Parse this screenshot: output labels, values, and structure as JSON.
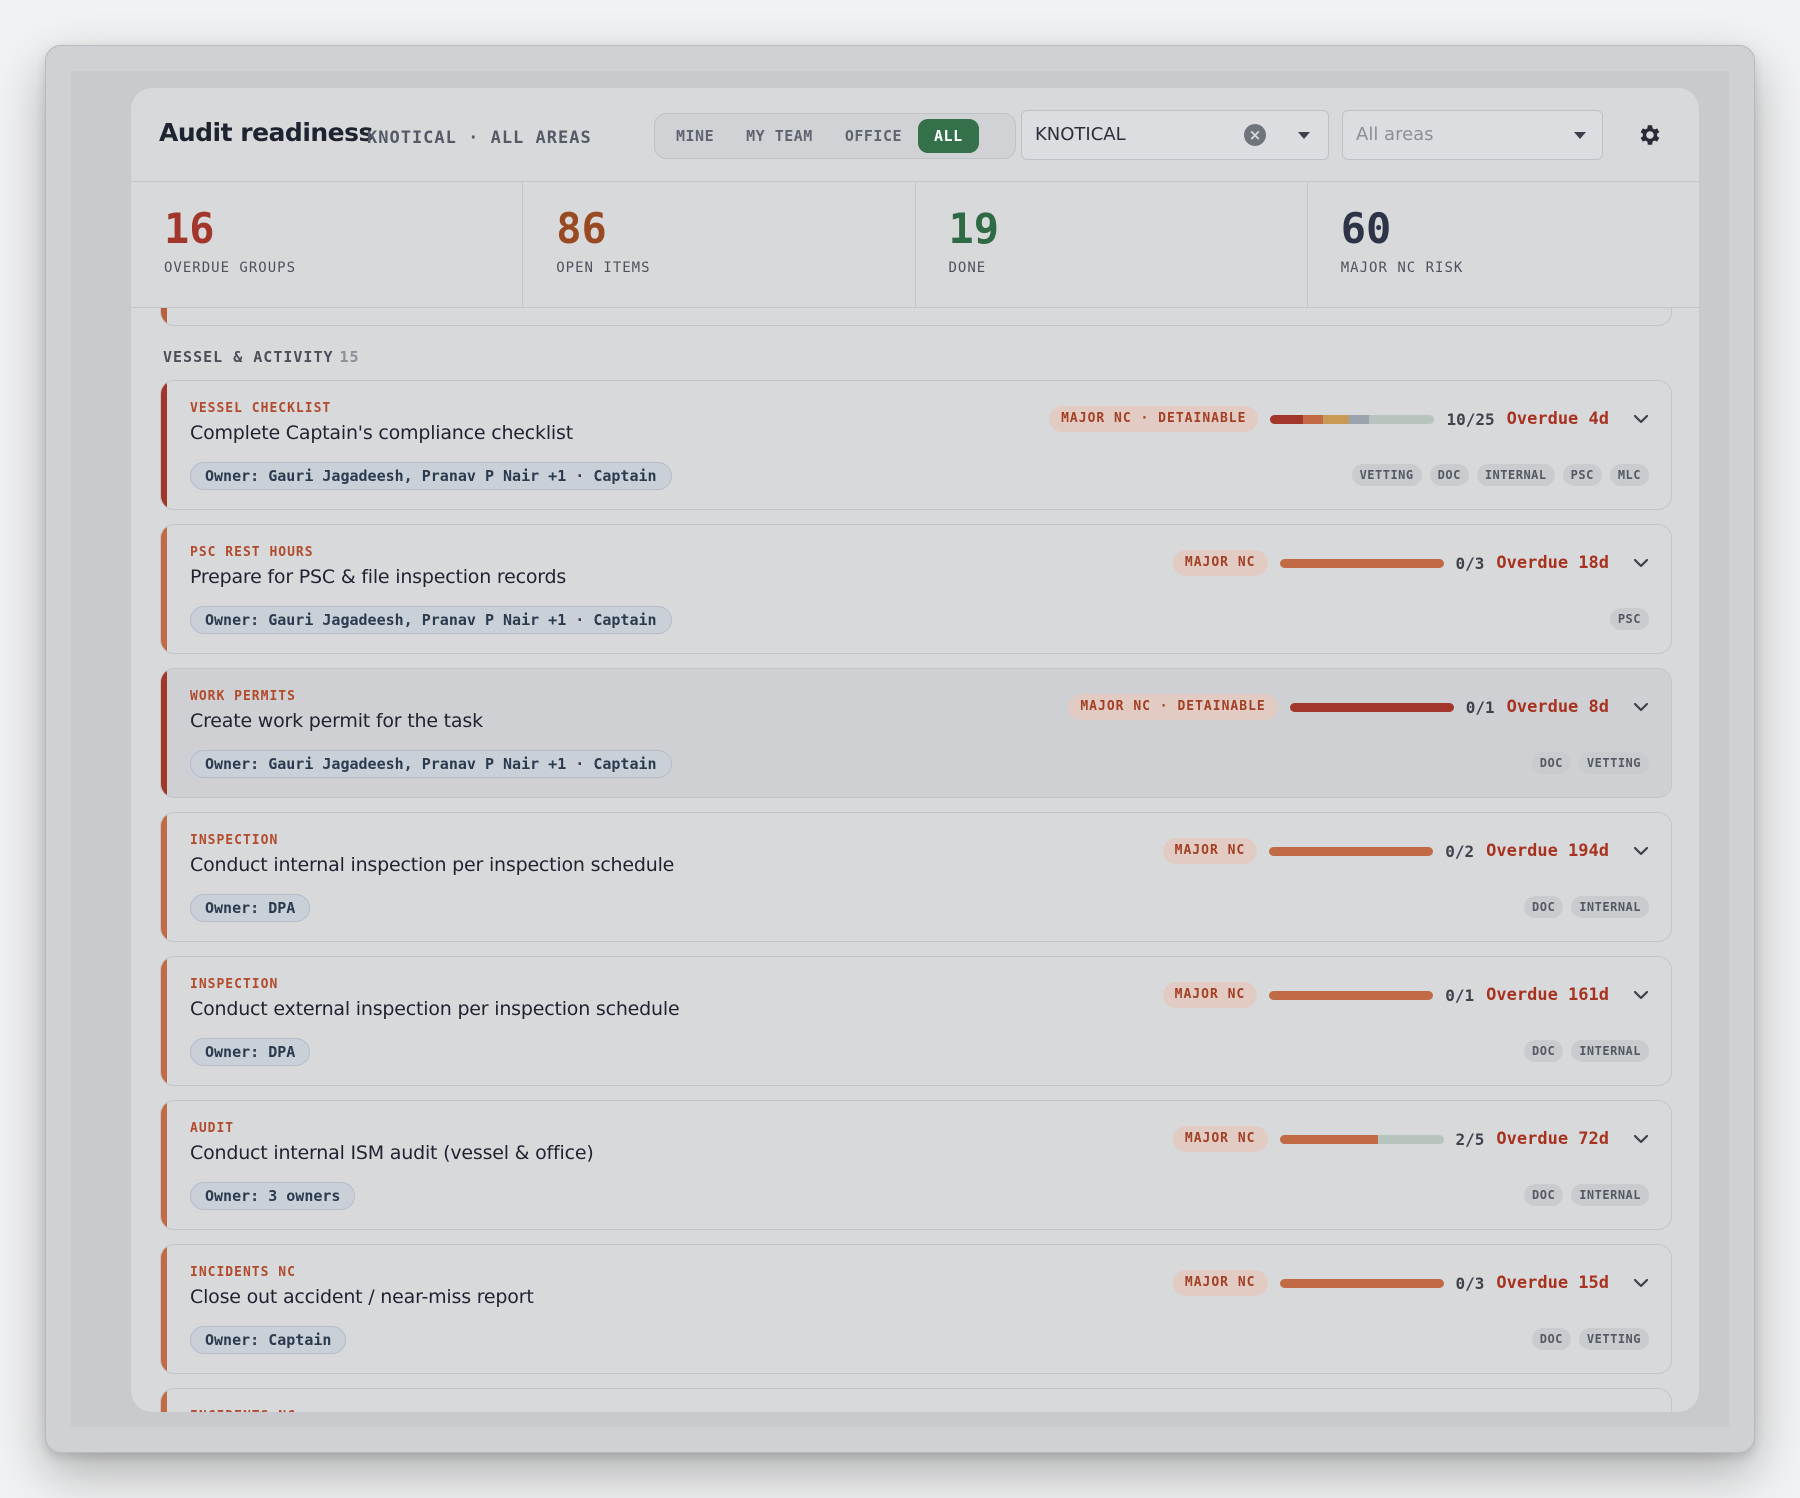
{
  "header": {
    "title": "Audit readiness",
    "subtitle": "KNOTICAL · ALL AREAS",
    "scope_tabs": [
      {
        "label": "MINE",
        "active": false
      },
      {
        "label": "MY TEAM",
        "active": false
      },
      {
        "label": "OFFICE",
        "active": false
      },
      {
        "label": "ALL",
        "active": true
      }
    ],
    "vessel_select": {
      "value": "KNOTICAL",
      "clear_icon": "close-circle-icon",
      "caret_icon": "caret-down-icon"
    },
    "area_select": {
      "placeholder": "All areas",
      "caret_icon": "caret-down-icon"
    },
    "settings_icon": "gear-icon"
  },
  "stats": [
    {
      "value": "16",
      "label": "OVERDUE GROUPS",
      "color": "#a3362a"
    },
    {
      "value": "86",
      "label": "OPEN ITEMS",
      "color": "#9a4a22"
    },
    {
      "value": "19",
      "label": "DONE",
      "color": "#2f6a45"
    },
    {
      "value": "60",
      "label": "MAJOR NC RISK",
      "color": "#2e3447"
    }
  ],
  "section": {
    "label": "VESSEL & ACTIVITY",
    "count": "15"
  },
  "colors": {
    "critical_accent": "#a3362a",
    "major_accent": "#c16a45",
    "active_tab": "#34704a",
    "overdue_text": "#a83220"
  },
  "cards": [
    {
      "category": "VESSEL CHECKLIST",
      "title": "Complete Captain's compliance checklist",
      "owner": "Owner: Gauri Jagadeesh, Pranav P Nair +1 · Captain",
      "badge": "MAJOR NC · DETAINABLE",
      "progress_text": "10/25",
      "progress": 0.4,
      "segments": [
        {
          "value": 0.2,
          "color": "#a3362a"
        },
        {
          "value": 0.12,
          "color": "#c16a45"
        },
        {
          "value": 0.16,
          "color": "#c99a55"
        },
        {
          "value": 0.12,
          "color": "#9aa3ae"
        }
      ],
      "status": "Overdue 4d",
      "tags": [
        "VETTING",
        "DOC",
        "INTERNAL",
        "PSC",
        "MLC"
      ],
      "accent": "#a3362a",
      "hover": false
    },
    {
      "category": "PSC REST HOURS",
      "title": "Prepare for PSC & file inspection records",
      "owner": "Owner: Gauri Jagadeesh, Pranav P Nair +1 · Captain",
      "badge": "MAJOR NC",
      "progress_text": "0/3",
      "progress": 0,
      "segments": [
        {
          "value": 1,
          "color": "#c16a45"
        }
      ],
      "status": "Overdue 18d",
      "tags": [
        "PSC"
      ],
      "accent": "#c16a45",
      "hover": false
    },
    {
      "category": "WORK PERMITS",
      "title": "Create work permit for the task",
      "owner": "Owner: Gauri Jagadeesh, Pranav P Nair +1 · Captain",
      "badge": "MAJOR NC · DETAINABLE",
      "progress_text": "0/1",
      "progress": 0,
      "segments": [
        {
          "value": 1,
          "color": "#a3362a"
        }
      ],
      "status": "Overdue 8d",
      "tags": [
        "DOC",
        "VETTING"
      ],
      "accent": "#a3362a",
      "hover": true
    },
    {
      "category": "INSPECTION",
      "title": "Conduct internal inspection per inspection schedule",
      "owner": "Owner: DPA",
      "badge": "MAJOR NC",
      "progress_text": "0/2",
      "progress": 0,
      "segments": [
        {
          "value": 1,
          "color": "#c16a45"
        }
      ],
      "status": "Overdue 194d",
      "tags": [
        "DOC",
        "INTERNAL"
      ],
      "accent": "#c16a45",
      "hover": false
    },
    {
      "category": "INSPECTION",
      "title": "Conduct external inspection per inspection schedule",
      "owner": "Owner: DPA",
      "badge": "MAJOR NC",
      "progress_text": "0/1",
      "progress": 0,
      "segments": [
        {
          "value": 1,
          "color": "#c16a45"
        }
      ],
      "status": "Overdue 161d",
      "tags": [
        "DOC",
        "INTERNAL"
      ],
      "accent": "#c16a45",
      "hover": false
    },
    {
      "category": "AUDIT",
      "title": "Conduct internal ISM audit (vessel & office)",
      "owner": "Owner: 3 owners",
      "badge": "MAJOR NC",
      "progress_text": "2/5",
      "progress": 0.4,
      "segments": [
        {
          "value": 0.6,
          "color": "#c16a45"
        }
      ],
      "status": "Overdue 72d",
      "tags": [
        "DOC",
        "INTERNAL"
      ],
      "accent": "#c16a45",
      "hover": false
    },
    {
      "category": "INCIDENTS NC",
      "title": "Close out accident / near-miss report",
      "owner": "Owner: Captain",
      "badge": "MAJOR NC",
      "progress_text": "0/3",
      "progress": 0,
      "segments": [
        {
          "value": 1,
          "color": "#c16a45"
        }
      ],
      "status": "Overdue 15d",
      "tags": [
        "DOC",
        "VETTING"
      ],
      "accent": "#c16a45",
      "hover": false
    },
    {
      "category": "INCIDENTS NC",
      "title": "",
      "owner": "",
      "badge": "",
      "progress_text": "",
      "progress": 0,
      "segments": [],
      "status": "",
      "tags": [],
      "accent": "#c16a45",
      "hover": false
    }
  ]
}
